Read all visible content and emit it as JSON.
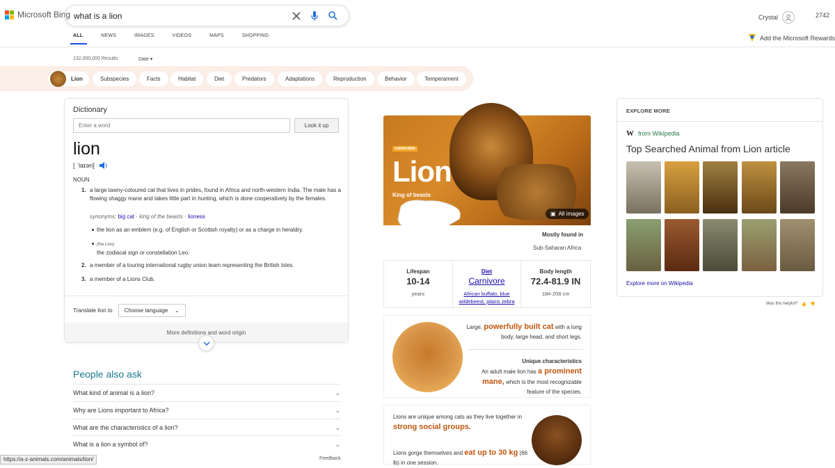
{
  "header": {
    "brand": "Microsoft Bing",
    "query": "what is a lion",
    "user": "Crystal",
    "points": "2742",
    "rewards": "Add the Microsoft Rewards"
  },
  "tabs": [
    "ALL",
    "NEWS",
    "IMAGES",
    "VIDEOS",
    "MAPS",
    "SHOPPING"
  ],
  "results": {
    "count": "132,000,000 Results",
    "date_filter": "Date"
  },
  "pills": [
    "Lion",
    "Subspecies",
    "Facts",
    "Habitat",
    "Diet",
    "Predators",
    "Adaptations",
    "Reproduction",
    "Behavior",
    "Temperament"
  ],
  "dictionary": {
    "label": "Dictionary",
    "input_placeholder": "Enter a word",
    "lookup": "Look it up",
    "word": "lion",
    "pronunciation": "[ ˈlaɪən]",
    "pos": "NOUN",
    "def1": "a large tawny-coloured cat that lives in prides, found in Africa and north-western India. The male has a flowing shaggy mane and takes little part in hunting, which is done cooperatively by the females.",
    "synonyms_label": "synonyms:",
    "syn1": "big cat",
    "syn2": "king of the beasts",
    "syn3": "lioness",
    "sub1": "the lion as an emblem (e.g. of English or Scottish royalty) or as a charge in heraldry.",
    "sub2_tag": "(the Lion)",
    "sub2": "the zodiacal sign or constellation Leo.",
    "def2": "a member of a touring international rugby union team representing the British Isles.",
    "def3": "a member of a Lions Club.",
    "translate_label": "Translate lion to",
    "translate_select": "Choose language",
    "more": "More definitions and word origin"
  },
  "paa": {
    "title": "People also ask",
    "questions": [
      "What kind of animal is a lion?",
      "Why are Lions important to Africa?",
      "What are the characteristics of a lion?",
      "What is a lion a symbol of?"
    ]
  },
  "status_url": "https://a-z-animals.com/animals/lion/",
  "feedback": "Feedback",
  "panel": {
    "badge": "vulnerable",
    "title": "Lion",
    "subtitle": "King of beasts",
    "all_images": "All images",
    "mostly_found": "Mostly found in",
    "region": "Sub-Saharan Africa",
    "lifespan_h": "Lifespan",
    "lifespan_v": "10-14",
    "lifespan_s": "years",
    "diet_h": "Diet",
    "diet_v": "Carnivore",
    "diet_s": "African buffalo, blue wildebeest, plains zebra",
    "body_h": "Body length",
    "body_v": "72.4-81.9 IN",
    "body_s": "184-208 cm",
    "a1_pre": "Large,",
    "a1_hl": "powerfully built cat",
    "a1_post": "with a long body, large head, and short legs.",
    "a2_head": "Unique characteristics",
    "a2_pre": "An adult male lion has",
    "a2_hl1": "a prominent",
    "a2_hl2": "mane,",
    "a2_post": "which is the most recognizable feature of the species.",
    "b1": "Lions are unique among cats as they live together in",
    "b1_hl": "strong social groups.",
    "b2_pre": "Lions gorge themselves and",
    "b2_hl": "eat up to 30 kg",
    "b2_post": "(66 lb) in one session."
  },
  "explore": {
    "heading": "EXPLORE MORE",
    "source": "from Wikipedia",
    "title": "Top Searched Animal from Lion article",
    "more": "Explore more on Wikipedia",
    "helpful": "Was this helpful?"
  },
  "colors": {
    "accent": "#174ae4",
    "orange": "#c0560f",
    "hero": "#c87a1f"
  }
}
